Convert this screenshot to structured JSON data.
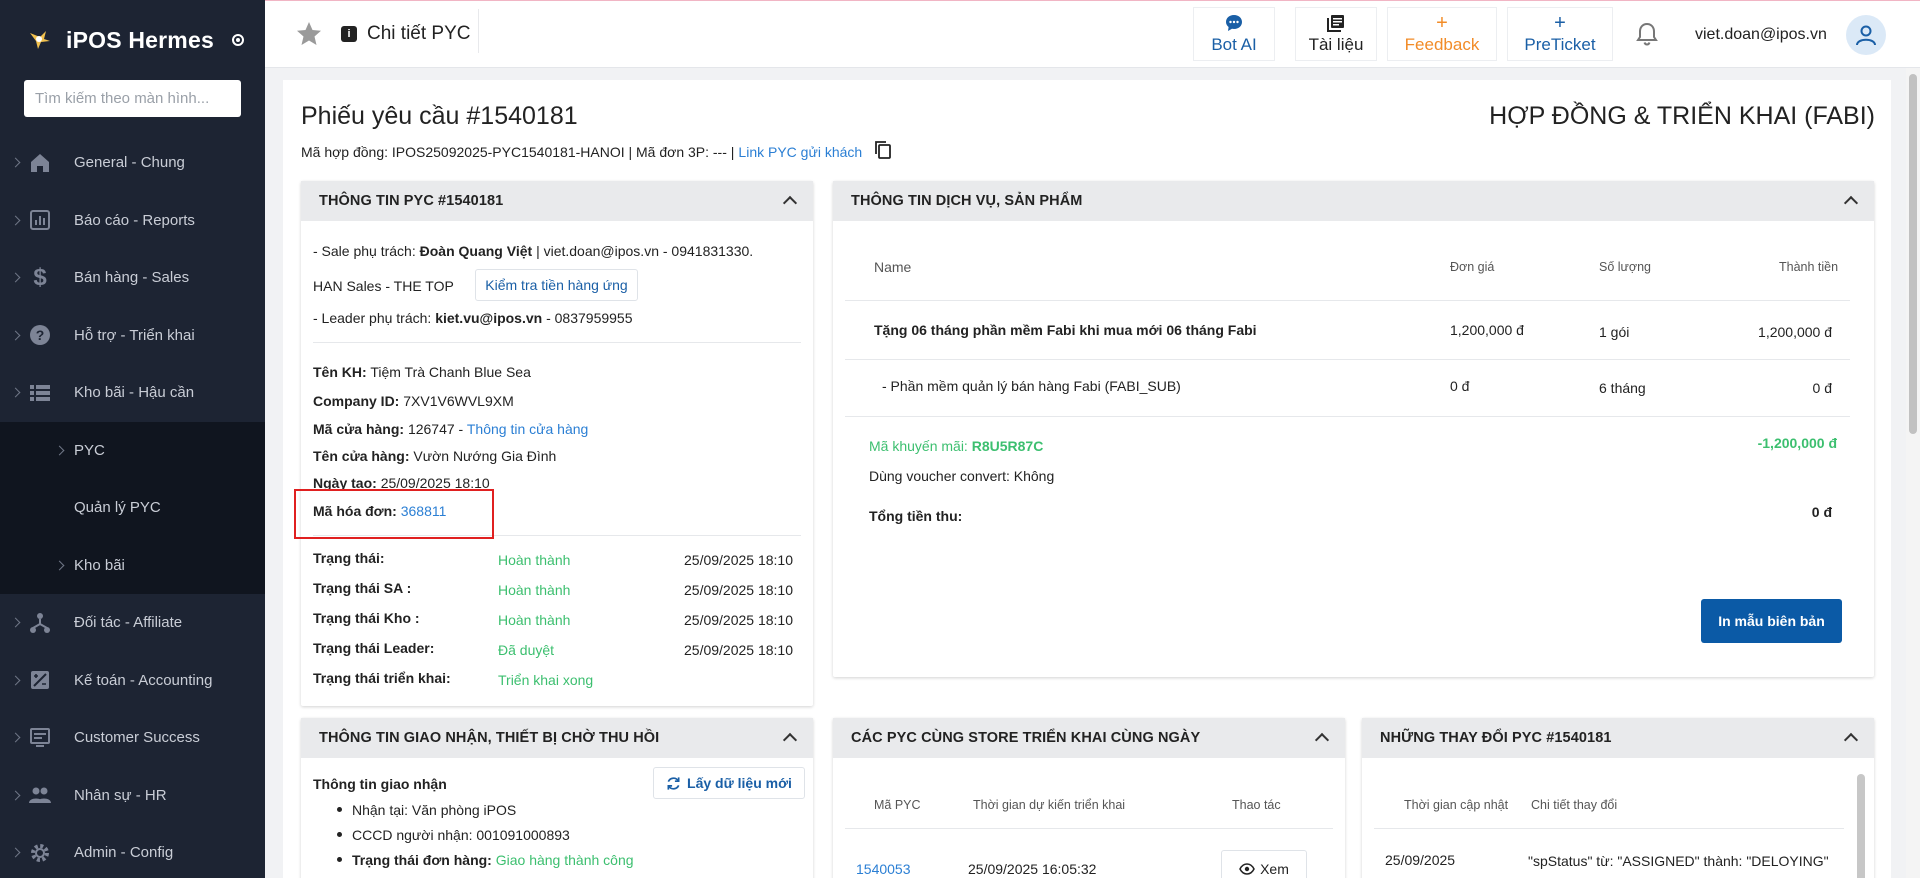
{
  "sidebar": {
    "brand": "iPOS Hermes",
    "search_placeholder": "Tìm kiếm theo màn hình...",
    "items": [
      {
        "label": "General - Chung",
        "icon": "home-icon"
      },
      {
        "label": "Báo cáo - Reports",
        "icon": "report-icon"
      },
      {
        "label": "Bán hàng - Sales",
        "icon": "dollar-icon"
      },
      {
        "label": "Hỗ trợ - Triển khai",
        "icon": "help-icon"
      },
      {
        "label": "Kho bãi - Hậu cần",
        "icon": "list-icon"
      }
    ],
    "sub_items": [
      {
        "label": "PYC"
      },
      {
        "label": "Quản lý PYC"
      },
      {
        "label": "Kho bãi"
      }
    ],
    "items_after": [
      {
        "label": "Đối tác - Affiliate",
        "icon": "network-icon"
      },
      {
        "label": "Kế toán - Accounting",
        "icon": "accounting-icon"
      },
      {
        "label": "Customer Success",
        "icon": "monitor-icon"
      },
      {
        "label": "Nhân sự - HR",
        "icon": "people-icon"
      },
      {
        "label": "Admin - Config",
        "icon": "gear-icon"
      }
    ]
  },
  "header": {
    "title": "Chi tiết PYC",
    "buttons": [
      {
        "label": "Bot AI",
        "icon": "chat-icon"
      },
      {
        "label": "Tài liệu",
        "icon": "document-icon"
      },
      {
        "label": "Feedback",
        "icon": "plus-icon"
      },
      {
        "label": "PreTicket",
        "icon": "plus-icon"
      }
    ],
    "user": "viet.doan@ipos.vn"
  },
  "page": {
    "title": "Phiếu yêu cầu #1540181",
    "contract_line": "Mã hợp đồng: IPOS25092025-PYC1540181-HANOI | Mã đơn 3P: --- |",
    "customer_link": "Link PYC gửi khách",
    "right_title": "HỢP ĐỒNG & TRIỂN KHAI (FABI)"
  },
  "pyc_info": {
    "header": "THÔNG TIN PYC #1540181",
    "sale_prefix": "- Sale phụ trách:",
    "sale_name": "Đoàn Quang Việt",
    "sale_contact": "| viet.doan@ipos.vn - 0941831330.",
    "sale_team": "HAN Sales - THE TOP",
    "check_button": "Kiểm tra tiền hàng ứng",
    "leader_prefix": "- Leader phụ trách:",
    "leader_email": "kiet.vu@ipos.vn",
    "leader_phone": "- 0837959955",
    "customer_label": "Tên KH:",
    "customer_value": "Tiệm Trà Chanh Blue Sea",
    "company_label": "Company ID:",
    "company_value": "7XV1V6WVL9XM",
    "store_code_label": "Mã cửa hàng:",
    "store_code_value": "126747 -",
    "store_info_link": "Thông tin cửa hàng",
    "store_name_label": "Tên cửa hàng:",
    "store_name_value": "Vườn Nướng Gia Đình",
    "created_label": "Ngày tạo:",
    "created_value": "25/09/2025 18:10",
    "invoice_label": "Mã hóa đơn:",
    "invoice_value": "368811",
    "statuses": [
      {
        "label": "Trạng thái:",
        "value": "Hoàn thành",
        "time": "25/09/2025 18:10"
      },
      {
        "label": "Trạng thái SA :",
        "value": "Hoàn thành",
        "time": "25/09/2025 18:10"
      },
      {
        "label": "Trạng thái Kho :",
        "value": "Hoàn thành",
        "time": "25/09/2025 18:10"
      },
      {
        "label": "Trạng thái Leader:",
        "value": "Đã duyệt",
        "time": "25/09/2025 18:10"
      },
      {
        "label": "Trạng thái triển khai:",
        "value": "Triển khai xong",
        "time": ""
      }
    ]
  },
  "service_info": {
    "header": "THÔNG TIN DỊCH VỤ, SẢN PHẨM",
    "columns": [
      "Name",
      "Đơn giá",
      "Số lượng",
      "Thành tiền"
    ],
    "rows": [
      {
        "name": "Tặng 06 tháng phần mềm Fabi khi mua mới 06 tháng Fabi",
        "price": "1,200,000 đ",
        "qty": "1 gói",
        "total": "1,200,000 đ"
      },
      {
        "name": "- Phần mềm quản lý bán hàng Fabi (FABI_SUB)",
        "price": "0 đ",
        "qty": "6 tháng",
        "total": "0 đ"
      }
    ],
    "promo_label": "Mã khuyến mãi:",
    "promo_code": "R8U5R87C",
    "promo_amount": "-1,200,000 đ",
    "voucher": "Dùng voucher convert: Không",
    "total_label": "Tổng tiền thu:",
    "total_value": "0 đ",
    "print_button": "In mẫu biên bản"
  },
  "delivery": {
    "header": "THÔNG TIN GIAO NHẬN, THIẾT BỊ CHỜ THU HỒI",
    "section": "Thông tin giao nhận",
    "refresh_button": "Lấy dữ liệu mới",
    "items": [
      {
        "label": "Nhận tại: Văn phòng iPOS"
      },
      {
        "label": "CCCD người nhận: 001091000893"
      }
    ],
    "order_status_label": "Trạng thái đơn hàng:",
    "order_status_value": "Giao hàng thành công"
  },
  "same_store": {
    "header": "CÁC PYC CÙNG STORE TRIỂN KHAI CÙNG NGÀY",
    "columns": [
      "Mã PYC",
      "Thời gian dự kiến triển khai",
      "Thao tác"
    ],
    "rows": [
      {
        "id": "1540053",
        "time": "25/09/2025 16:05:32",
        "action": "Xem"
      }
    ]
  },
  "changes": {
    "header": "NHỮNG THAY ĐỔI PYC #1540181",
    "columns": [
      "Thời gian cập nhật",
      "Chi tiết thay đổi"
    ],
    "rows": [
      {
        "time": "25/09/2025",
        "detail": "\"spStatus\" từ: \"ASSIGNED\" thành: \"DELOYING\""
      }
    ]
  },
  "colors": {
    "sidebar_bg": "#1d2433",
    "accent_blue": "#0b5aa6",
    "link_blue": "#2b7fd4",
    "success_green": "#3cbf6f",
    "feedback_orange": "#f28c28"
  }
}
